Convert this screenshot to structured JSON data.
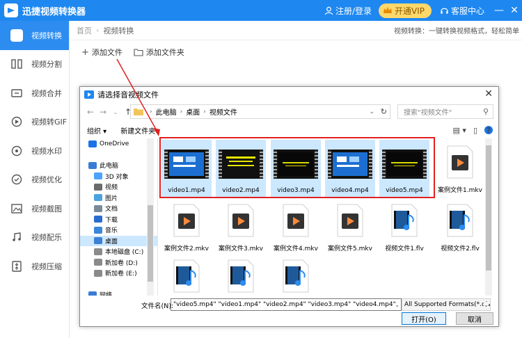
{
  "app": {
    "title": "迅捷视频转换器",
    "register_login": "注册/登录",
    "vip": "开通VIP",
    "customer_center": "客服中心",
    "minimize": "—",
    "close": "✕"
  },
  "sidebar": {
    "items": [
      {
        "label": "视频转换",
        "icon": "convert-icon",
        "active": true
      },
      {
        "label": "视频分割",
        "icon": "split-icon"
      },
      {
        "label": "视频合并",
        "icon": "merge-icon"
      },
      {
        "label": "视频转GIF",
        "icon": "gif-icon"
      },
      {
        "label": "视频水印",
        "icon": "watermark-icon"
      },
      {
        "label": "视频优化",
        "icon": "optimize-icon"
      },
      {
        "label": "视频截图",
        "icon": "screenshot-icon"
      },
      {
        "label": "视频配乐",
        "icon": "music-icon"
      },
      {
        "label": "视频压缩",
        "icon": "compress-icon"
      }
    ]
  },
  "breadcrumb": {
    "home": "首页",
    "sep": "›",
    "current": "视频转换",
    "description": "视频转换：一键转换视频格式，轻松简单"
  },
  "toolbar": {
    "add_file": "添加文件",
    "add_folder": "添加文件夹"
  },
  "dialog": {
    "title": "请选择音视频文件",
    "close": "✕",
    "address": {
      "parts": [
        "此电脑",
        "桌面",
        "视频文件"
      ],
      "sep": "›"
    },
    "search_placeholder": "搜索\"视频文件\"",
    "organize": "组织 ▾",
    "new_folder": "新建文件夹",
    "help": "?",
    "nav_items": [
      {
        "label": "OneDrive",
        "icon": "cloud-icon"
      },
      {
        "label": "",
        "icon": ""
      },
      {
        "label": "此电脑",
        "icon": "pc-icon"
      },
      {
        "label": "3D 对象",
        "icon": "3d-icon"
      },
      {
        "label": "视频",
        "icon": "video-folder-icon"
      },
      {
        "label": "图片",
        "icon": "picture-folder-icon"
      },
      {
        "label": "文档",
        "icon": "document-folder-icon"
      },
      {
        "label": "下载",
        "icon": "download-icon"
      },
      {
        "label": "音乐",
        "icon": "music-folder-icon"
      },
      {
        "label": "桌面",
        "icon": "desktop-folder-icon",
        "selected": true
      },
      {
        "label": "本地磁盘 (C:)",
        "icon": "drive-icon"
      },
      {
        "label": "新加卷 (D:)",
        "icon": "drive-icon"
      },
      {
        "label": "新加卷 (E:)",
        "icon": "drive-icon"
      },
      {
        "label": "",
        "icon": ""
      },
      {
        "label": "网络",
        "icon": "network-icon"
      }
    ],
    "files": [
      {
        "name": "video1.mp4",
        "kind": "video",
        "selected": true,
        "theme": "blue"
      },
      {
        "name": "video2.mp4",
        "kind": "video",
        "selected": true,
        "theme": "text"
      },
      {
        "name": "video3.mp4",
        "kind": "video",
        "selected": true,
        "theme": "dark"
      },
      {
        "name": "video4.mp4",
        "kind": "video",
        "selected": true,
        "theme": "blue"
      },
      {
        "name": "video5.mp4",
        "kind": "video",
        "selected": true,
        "theme": "dark"
      },
      {
        "name": "案例文件1.mkv",
        "kind": "mkv"
      },
      {
        "name": "案例文件2.mkv",
        "kind": "mkv"
      },
      {
        "name": "案例文件3.mkv",
        "kind": "mkv"
      },
      {
        "name": "案例文件4.mkv",
        "kind": "mkv"
      },
      {
        "name": "案例文件5.mkv",
        "kind": "mkv"
      },
      {
        "name": "视频文件1.flv",
        "kind": "flv"
      },
      {
        "name": "视频文件2.flv",
        "kind": "flv"
      },
      {
        "name": "",
        "kind": "flv"
      },
      {
        "name": "",
        "kind": "flv"
      },
      {
        "name": "",
        "kind": "flv"
      }
    ],
    "filename_label": "文件名(N):",
    "filename_value": "\"video5.mp4\" \"video1.mp4\" \"video2.mp4\" \"video3.mp4\" \"video4.mp4\"",
    "format_value": "All Supported Formats(*.qlv;",
    "open_button": "打开(O)",
    "cancel_button": "取消"
  },
  "colors": {
    "brand": "#1e88f0",
    "active_sidebar": "#2d8cf0",
    "selection": "#cce8ff",
    "highlight_border": "#e02020"
  }
}
